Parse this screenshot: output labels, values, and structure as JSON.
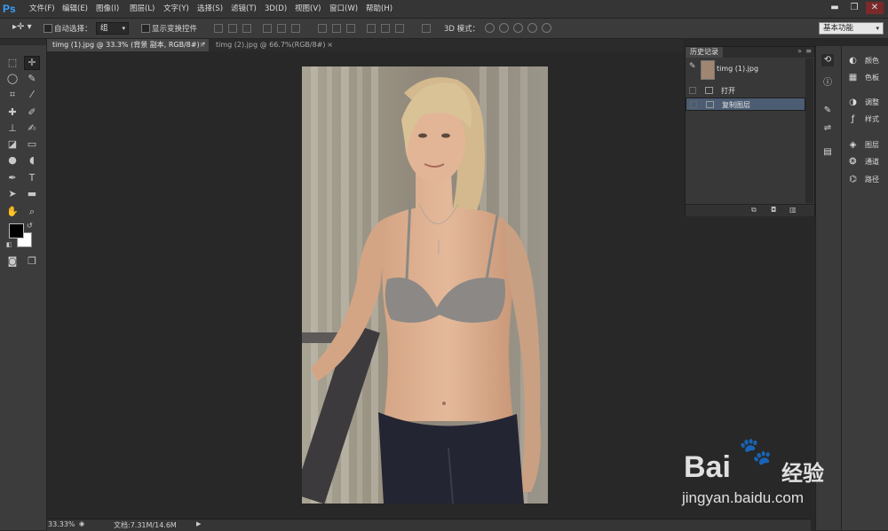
{
  "app": {
    "logo": "Ps"
  },
  "menu": [
    "文件(F)",
    "编辑(E)",
    "图像(I)",
    "图层(L)",
    "文字(Y)",
    "选择(S)",
    "滤镜(T)",
    "3D(D)",
    "视图(V)",
    "窗口(W)",
    "帮助(H)"
  ],
  "window_controls": {
    "minimize": "▬",
    "restore": "❐",
    "close": "✕"
  },
  "options": {
    "auto_select_label": "自动选择：",
    "auto_select_value": "组",
    "show_transform_label": "显示变换控件",
    "mode_3d_label": "3D 模式：",
    "workspace": "基本功能"
  },
  "tabs": [
    {
      "title": "timg (1).jpg @ 33.3% (背景 副本, RGB/8#) *",
      "active": true
    },
    {
      "title": "timg (2).jpg @ 66.7%(RGB/8#)",
      "active": false
    }
  ],
  "status": {
    "zoom": "33.33%",
    "doc": "文档:7.31M/14.6M"
  },
  "history_panel": {
    "tab": "历史记录",
    "snapshot": "timg (1).jpg",
    "items": [
      {
        "label": "打开",
        "selected": false
      },
      {
        "label": "复制图层",
        "selected": true
      }
    ]
  },
  "panels": [
    {
      "label": "颜色",
      "icon": "color-icon"
    },
    {
      "label": "色板",
      "icon": "swatches-icon"
    },
    {
      "label": "调整",
      "icon": "adjustments-icon"
    },
    {
      "label": "样式",
      "icon": "styles-icon"
    },
    {
      "label": "图层",
      "icon": "layers-icon"
    },
    {
      "label": "通道",
      "icon": "channels-icon"
    },
    {
      "label": "路径",
      "icon": "paths-icon"
    }
  ],
  "watermark": {
    "brand": "Bai",
    "brand_suffix": "经验",
    "url": "jingyan.baidu.com"
  },
  "colors": {
    "accent": "#3aa0ff",
    "selection": "#4c5d73",
    "canvas_bg": "#282828"
  }
}
